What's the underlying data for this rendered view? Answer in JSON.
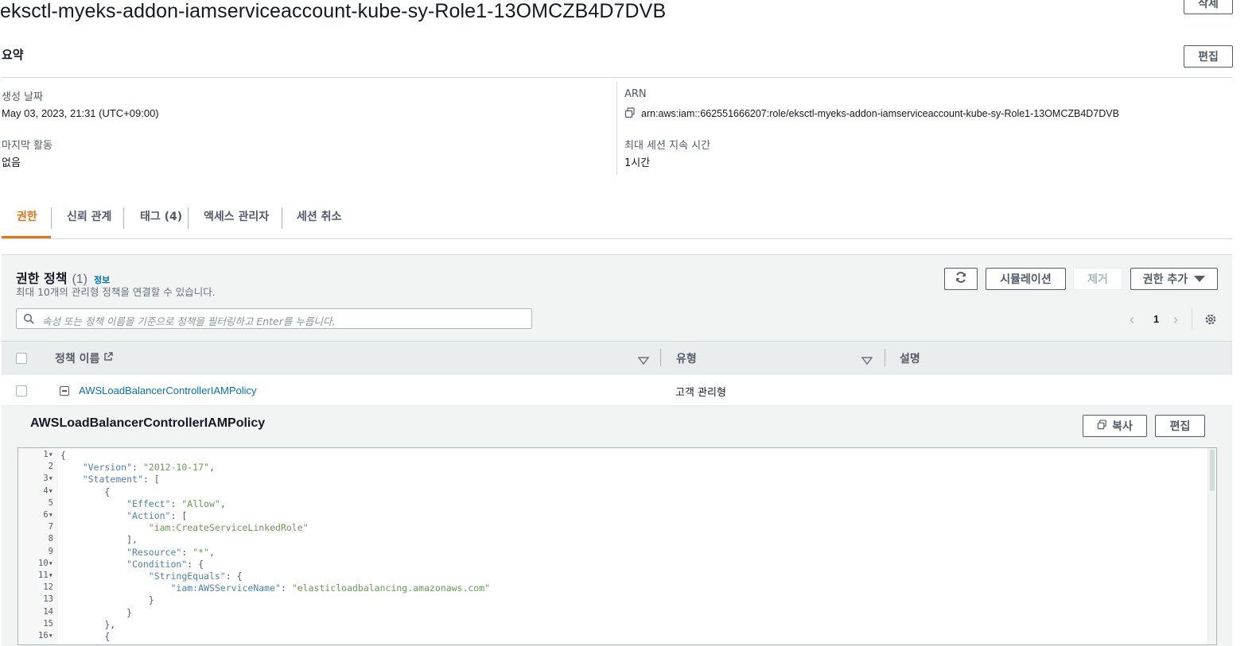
{
  "role": {
    "name": "eksctl-myeks-addon-iamserviceaccount-kube-sy-Role1-13OMCZB4D7DVB",
    "delete_label": "삭제"
  },
  "summary": {
    "heading": "요약",
    "edit_label": "편집",
    "created_label": "생성 날짜",
    "created_value": "May 03, 2023, 21:31 (UTC+09:00)",
    "last_activity_label": "마지막 활동",
    "last_activity_value": "없음",
    "arn_label": "ARN",
    "arn_value": "arn:aws:iam::662551666207:role/eksctl-myeks-addon-iamserviceaccount-kube-sy-Role1-13OMCZB4D7DVB",
    "max_session_label": "최대 세션 지속 시간",
    "max_session_value": "1시간"
  },
  "tabs": [
    {
      "label": "권한"
    },
    {
      "label": "신뢰 관계"
    },
    {
      "label": "태그 (4)"
    },
    {
      "label": "액세스 관리자"
    },
    {
      "label": "세션 취소"
    }
  ],
  "policies": {
    "heading": "권한 정책",
    "count": "(1)",
    "info_link": "정보",
    "description": "최대 10개의 관리형 정책을 연결할 수 있습니다.",
    "simulate_label": "시뮬레이션",
    "remove_label": "제거",
    "add_label": "권한 추가",
    "search_placeholder": "속성 또는 정책 이름을 기준으로 정책을 필터링하고 Enter를 누릅니다.",
    "page_number": "1",
    "columns": [
      "정책 이름",
      "유형",
      "설명"
    ],
    "rows": [
      {
        "name": "AWSLoadBalancerControllerIAMPolicy",
        "type": "고객 관리형",
        "description": ""
      }
    ]
  },
  "policy_detail": {
    "title": "AWSLoadBalancerControllerIAMPolicy",
    "copy_label": "복사",
    "edit_label": "편집",
    "code_lines": [
      {
        "n": "1",
        "fold": true,
        "text": "{"
      },
      {
        "n": "2",
        "fold": false,
        "text": "    \"Version\": \"2012-10-17\","
      },
      {
        "n": "3",
        "fold": true,
        "text": "    \"Statement\": ["
      },
      {
        "n": "4",
        "fold": true,
        "text": "        {"
      },
      {
        "n": "5",
        "fold": false,
        "text": "            \"Effect\": \"Allow\","
      },
      {
        "n": "6",
        "fold": true,
        "text": "            \"Action\": ["
      },
      {
        "n": "7",
        "fold": false,
        "text": "                \"iam:CreateServiceLinkedRole\""
      },
      {
        "n": "8",
        "fold": false,
        "text": "            ],"
      },
      {
        "n": "9",
        "fold": false,
        "text": "            \"Resource\": \"*\","
      },
      {
        "n": "10",
        "fold": true,
        "text": "            \"Condition\": {"
      },
      {
        "n": "11",
        "fold": true,
        "text": "                \"StringEquals\": {"
      },
      {
        "n": "12",
        "fold": false,
        "text": "                    \"iam:AWSServiceName\": \"elasticloadbalancing.amazonaws.com\""
      },
      {
        "n": "13",
        "fold": false,
        "text": "                }"
      },
      {
        "n": "14",
        "fold": false,
        "text": "            }"
      },
      {
        "n": "15",
        "fold": false,
        "text": "        },"
      },
      {
        "n": "16",
        "fold": true,
        "text": "        {"
      }
    ]
  },
  "colors": {
    "accent": "#ec7211",
    "link": "#0073bb",
    "json_key": "#4d80b3",
    "json_string": "#6a9955"
  }
}
